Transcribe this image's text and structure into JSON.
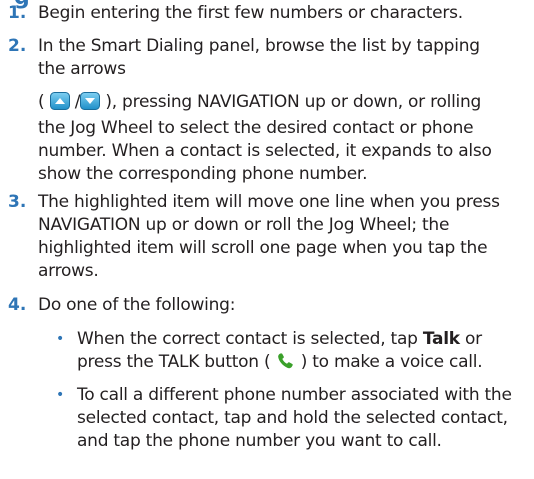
{
  "heading_fragment": "g",
  "steps": [
    {
      "number": "1.",
      "lines": [
        "Begin entering the first few numbers or characters."
      ]
    },
    {
      "number": "2.",
      "lines": [
        "In the Smart Dialing panel, browse the list by tapping",
        "the arrows"
      ],
      "para2_open": "(",
      "para2_slash": "/",
      "para2_line1_rest": "), pressing NAVIGATION up or down, or rolling",
      "para2_lines": [
        "the Jog Wheel to select the desired contact or phone",
        "number. When a contact is selected, it expands to also",
        "show the corresponding phone number."
      ]
    },
    {
      "number": "3.",
      "lines": [
        "The highlighted item will move one line when you press",
        "NAVIGATION up or down or roll the Jog Wheel; the",
        "highlighted item will scroll one page when you tap the",
        "arrows."
      ]
    },
    {
      "number": "4.",
      "lines": [
        "Do one of the following:"
      ]
    }
  ],
  "bullets": [
    {
      "marker": "•",
      "line1_pre": "When the correct contact is selected, tap ",
      "line1_bold": "Talk",
      "line1_post": " or",
      "line2_pre": "press the TALK button (",
      "line2_post": ") to make a voice call."
    },
    {
      "marker": "•",
      "lines": [
        "To call a different phone number associated with the",
        "selected contact, tap and hold the selected contact,",
        "and tap the phone number you want to call."
      ]
    }
  ],
  "icons": {
    "up_arrow": "up-arrow-button-icon",
    "down_arrow": "down-arrow-button-icon",
    "talk": "phone-handset-icon"
  },
  "colors": {
    "accent": "#2e75b6",
    "text": "#231f20",
    "talk_icon": "#3aa02a"
  }
}
